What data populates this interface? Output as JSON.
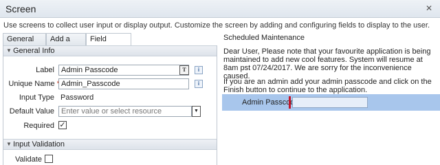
{
  "window": {
    "title": "Screen",
    "close_icon": "close-icon"
  },
  "description": "Use screens to collect user input or display output. Customize the screen by adding and configuring fields to display to the user.",
  "tabs": [
    {
      "label": "General Info"
    },
    {
      "label": "Add a Field"
    },
    {
      "label": "Field Settings",
      "active": true
    }
  ],
  "general_info": {
    "header": "General Info",
    "label_label": "Label",
    "label_value": "Admin Passcode",
    "unique_name_label": "Unique Name",
    "unique_name_value": "Admin_Passcode",
    "input_type_label": "Input Type",
    "input_type_value": "Password",
    "default_value_label": "Default Value",
    "default_value_placeholder": "Enter value or select resource",
    "required_label": "Required",
    "required_checked": true,
    "required_marker": "*",
    "info_glyph": "i",
    "text_glyph": "T"
  },
  "input_validation": {
    "header": "Input Validation",
    "validate_label": "Validate",
    "validate_checked": false
  },
  "preview": {
    "heading": "Scheduled Maintenance",
    "message": "Dear User, Please note that your favourite application is being maintained to add new cool features. System will resume at 8am pst 07/24/2017. We are sorry for the inconvenience caused.",
    "instruction": "If you are an admin add your admin passcode and click on the Finish button to continue to the application.",
    "field_label": "Admin Passcode"
  },
  "colors": {
    "accent": "#a8c6ec",
    "required_bar": "#c4162a"
  }
}
